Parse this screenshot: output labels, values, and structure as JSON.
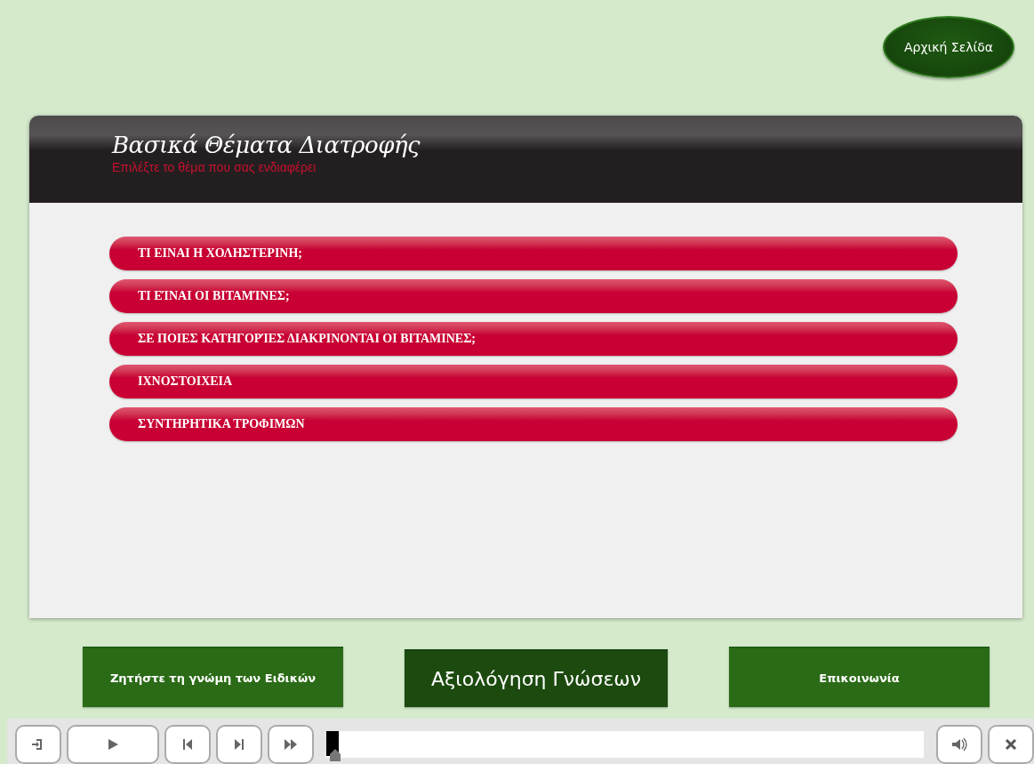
{
  "home_button": {
    "label": "Αρχική Σελίδα"
  },
  "panel": {
    "title": "Βασικά Θέματα Διατροφής",
    "subtitle": "Επιλέξτε το θέμα που σας ενδιαφέρει"
  },
  "topics": [
    {
      "label": "ΤΙ ΕΙΝΑΙ Η ΧΟΛΗΣΤΕΡΙΝΗ;"
    },
    {
      "label": "ΤΙ ΕΊΝΑΙ ΟΙ ΒΙΤΑΜΊΝΕΣ;"
    },
    {
      "label": "ΣΕ ΠΟΙΕΣ ΚΑΤΗΓΟΡΊΕΣ ΔΙΑΚΡΙΝΟΝΤΑΙ ΟΙ ΒΙΤΑΜΙΝΕΣ;"
    },
    {
      "label": "ΙΧΝΟΣΤΟΙΧΕΙΑ"
    },
    {
      "label": "ΣΥΝΤΗΡΗΤΙΚΑ ΤΡΟΦΙΜΩΝ"
    }
  ],
  "nav_buttons": [
    {
      "label": "Ζητήστε τη γνώμη των Ειδικών",
      "selected": false
    },
    {
      "label": "Αξιολόγηση Γνώσεων",
      "selected": true
    },
    {
      "label": "Επικοινωνία",
      "selected": false
    }
  ],
  "player": {
    "progress": {
      "level": 0
    }
  }
}
